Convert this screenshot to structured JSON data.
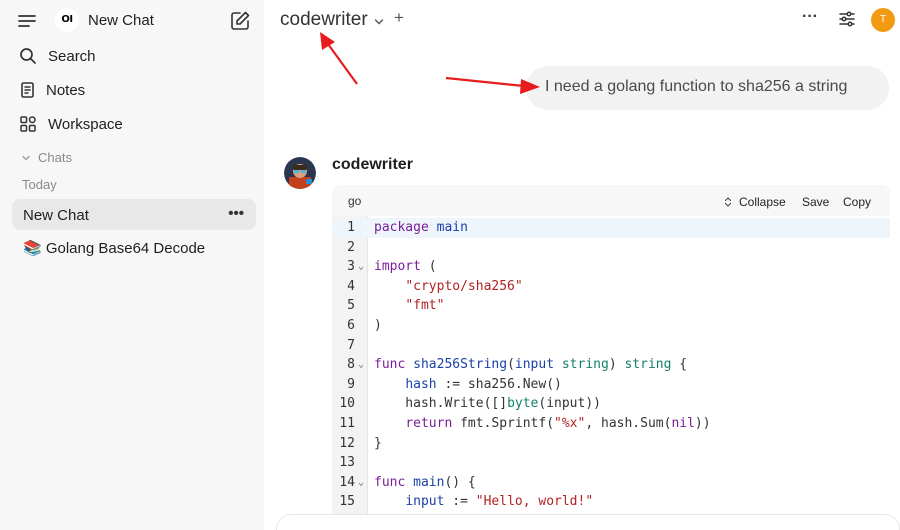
{
  "sidebar": {
    "logo_text": "OI",
    "title": "New Chat",
    "nav": [
      {
        "label": "Search",
        "icon": "search-icon"
      },
      {
        "label": "Notes",
        "icon": "notes-icon"
      },
      {
        "label": "Workspace",
        "icon": "workspace-icon"
      }
    ],
    "chats_label": "Chats",
    "group_label": "Today",
    "chats": [
      {
        "label": "New Chat",
        "active": true
      },
      {
        "label": "📚 Golang Base64 Decode",
        "active": false
      }
    ]
  },
  "header": {
    "model_name": "codewriter",
    "add_model": "+",
    "avatar_initial": "T",
    "avatar_color": "#f29a12"
  },
  "conversation": {
    "user_message": "I need a golang function to sha256 a string",
    "assistant_name": "codewriter",
    "code": {
      "language": "go",
      "collapse_label": "Collapse",
      "save_label": "Save",
      "copy_label": "Copy",
      "lines": [
        "package main",
        "",
        "import (",
        "    \"crypto/sha256\"",
        "    \"fmt\"",
        ")",
        "",
        "func sha256String(input string) string {",
        "    hash := sha256.New()",
        "    hash.Write([]byte(input))",
        "    return fmt.Sprintf(\"%x\", hash.Sum(nil))",
        "}",
        "",
        "func main() {",
        "    input := \"Hello, world!\""
      ]
    }
  }
}
